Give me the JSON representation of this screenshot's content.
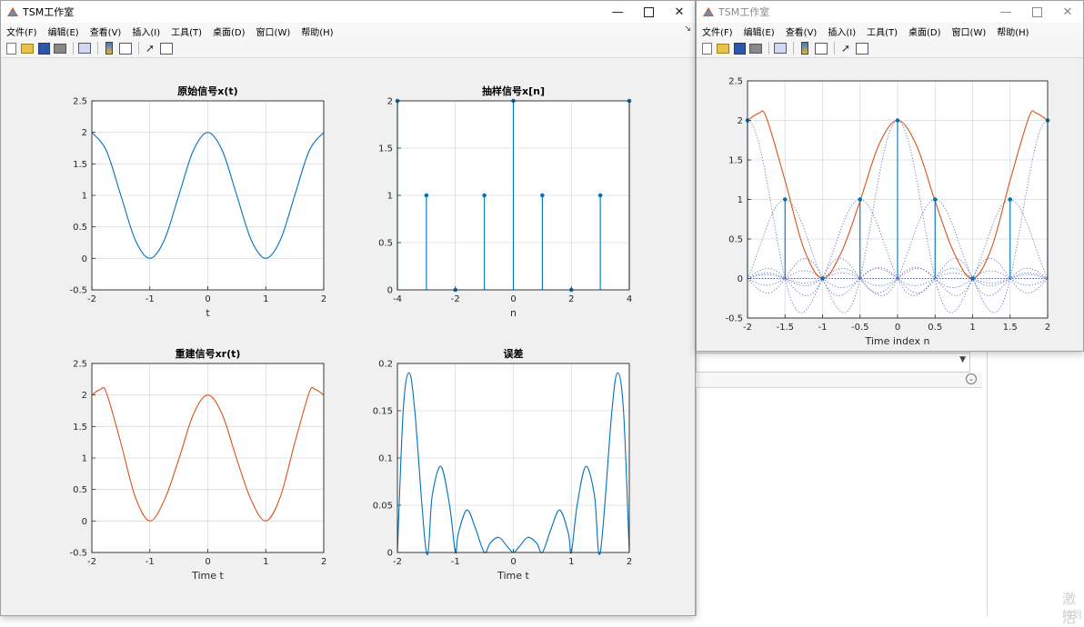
{
  "window_title": "TSM工作室",
  "menu": [
    "文件(F)",
    "编辑(E)",
    "查看(V)",
    "插入(I)",
    "工具(T)",
    "桌面(D)",
    "窗口(W)",
    "帮助(H)"
  ],
  "toolbar_icons": [
    "new-figure-icon",
    "open-file-icon",
    "save-icon",
    "print-icon",
    "link-plot-icon",
    "colorbar-icon",
    "legend-icon",
    "edit-plot-arrow-icon",
    "property-inspector-icon"
  ],
  "colors": {
    "blue": "#0072bd",
    "red": "#d95319",
    "dotted": "#4a5aa8",
    "grid": "#dcdcdc"
  },
  "watermark": [
    "激活",
    "转到"
  ],
  "chart_data": [
    {
      "type": "line",
      "title": "原始信号x(t)",
      "xlabel": "t",
      "ylabel": "",
      "xlim": [
        -2,
        2
      ],
      "ylim": [
        -0.5,
        2.5
      ],
      "xticks": [
        -2,
        -1,
        0,
        1,
        2
      ],
      "yticks": [
        -0.5,
        0,
        0.5,
        1,
        1.5,
        2,
        2.5
      ],
      "grid": true,
      "color": "#0072bd",
      "x": [
        -2,
        -1.75,
        -1.5,
        -1.25,
        -1,
        -0.75,
        -0.5,
        -0.25,
        0,
        0.25,
        0.5,
        0.75,
        1,
        1.25,
        1.5,
        1.75,
        2
      ],
      "y": [
        2,
        1.71,
        1,
        0.29,
        0,
        0.29,
        1,
        1.71,
        2,
        1.71,
        1,
        0.29,
        0,
        0.29,
        1,
        1.71,
        2
      ]
    },
    {
      "type": "stem",
      "title": "抽样信号x[n]",
      "xlabel": "n",
      "ylabel": "",
      "xlim": [
        -4,
        4
      ],
      "ylim": [
        0,
        2
      ],
      "xticks": [
        -4,
        -2,
        0,
        2,
        4
      ],
      "yticks": [
        0,
        0.5,
        1,
        1.5,
        2
      ],
      "grid": true,
      "color": "#0072bd",
      "x": [
        -4,
        -3,
        -2,
        -1,
        0,
        1,
        2,
        3,
        4
      ],
      "y": [
        2,
        1,
        0,
        1,
        2,
        1,
        0,
        1,
        2
      ]
    },
    {
      "type": "line",
      "title": "重建信号xr(t)",
      "xlabel": "Time t",
      "ylabel": "",
      "xlim": [
        -2,
        2
      ],
      "ylim": [
        -0.5,
        2.5
      ],
      "xticks": [
        -2,
        -1,
        0,
        1,
        2
      ],
      "yticks": [
        -0.5,
        0,
        0.5,
        1,
        1.5,
        2,
        2.5
      ],
      "grid": true,
      "color": "#d95319",
      "x": [
        -2,
        -1.85,
        -1.75,
        -1.5,
        -1.25,
        -1,
        -0.75,
        -0.5,
        -0.25,
        0,
        0.25,
        0.5,
        0.75,
        1,
        1.25,
        1.5,
        1.75,
        1.85,
        2
      ],
      "y": [
        2,
        2.09,
        2.04,
        1.24,
        0.38,
        0,
        0.33,
        0.98,
        1.69,
        2,
        1.69,
        0.98,
        0.33,
        0,
        0.38,
        1.24,
        2.04,
        2.09,
        2
      ]
    },
    {
      "type": "line",
      "title": "误差",
      "xlabel": "Time t",
      "ylabel": "",
      "xlim": [
        -2,
        2
      ],
      "ylim": [
        0,
        0.2
      ],
      "xticks": [
        -2,
        -1,
        0,
        1,
        2
      ],
      "yticks": [
        0,
        0.05,
        0.1,
        0.15,
        0.2
      ],
      "grid": true,
      "color": "#0072bd",
      "x": [
        -2,
        -1.9,
        -1.8,
        -1.7,
        -1.5,
        -1.4,
        -1.25,
        -1.1,
        -1,
        -0.95,
        -0.8,
        -0.65,
        -0.5,
        -0.4,
        -0.25,
        -0.1,
        0,
        0.1,
        0.25,
        0.4,
        0.5,
        0.65,
        0.8,
        0.95,
        1,
        1.1,
        1.25,
        1.4,
        1.5,
        1.7,
        1.8,
        1.9,
        2
      ],
      "y": [
        0,
        0.15,
        0.19,
        0.15,
        0,
        0.06,
        0.091,
        0.05,
        0,
        0.02,
        0.045,
        0.025,
        0,
        0.01,
        0.016,
        0.006,
        0,
        0.006,
        0.016,
        0.01,
        0,
        0.025,
        0.045,
        0.02,
        0,
        0.05,
        0.091,
        0.06,
        0,
        0.15,
        0.19,
        0.15,
        0
      ]
    },
    {
      "type": "line+stem",
      "title": "",
      "xlabel": "Time index n",
      "ylabel": "",
      "xlim": [
        -2,
        2
      ],
      "ylim": [
        -0.5,
        2.5
      ],
      "xticks": [
        -2,
        -1.5,
        -1,
        -0.5,
        0,
        0.5,
        1,
        1.5,
        2
      ],
      "yticks": [
        -0.5,
        0,
        0.5,
        1,
        1.5,
        2,
        2.5
      ],
      "grid": true,
      "series": [
        {
          "kind": "line",
          "color": "#d95319",
          "x": [
            -2,
            -1.85,
            -1.75,
            -1.5,
            -1.25,
            -1,
            -0.75,
            -0.5,
            -0.25,
            0,
            0.25,
            0.5,
            0.75,
            1,
            1.25,
            1.5,
            1.75,
            1.85,
            2
          ],
          "y": [
            2,
            2.09,
            2.04,
            1.24,
            0.38,
            0,
            0.33,
            0.98,
            1.69,
            2,
            1.69,
            0.98,
            0.33,
            0,
            0.38,
            1.24,
            2.04,
            2.09,
            2
          ]
        },
        {
          "kind": "stem",
          "color": "#0072bd",
          "x": [
            -2,
            -1.5,
            -1,
            -0.5,
            0,
            0.5,
            1,
            1.5,
            2
          ],
          "y": [
            2,
            1,
            0,
            1,
            2,
            1,
            0,
            1,
            2
          ]
        },
        {
          "kind": "sinc-components",
          "color": "#4a5aa8",
          "centers": [
            -2,
            -1.5,
            -1,
            -0.5,
            0,
            0.5,
            1,
            1.5,
            2
          ],
          "amplitudes": [
            2,
            1,
            0,
            1,
            2,
            1,
            0,
            1,
            2
          ],
          "spacing": 0.5
        }
      ]
    }
  ]
}
